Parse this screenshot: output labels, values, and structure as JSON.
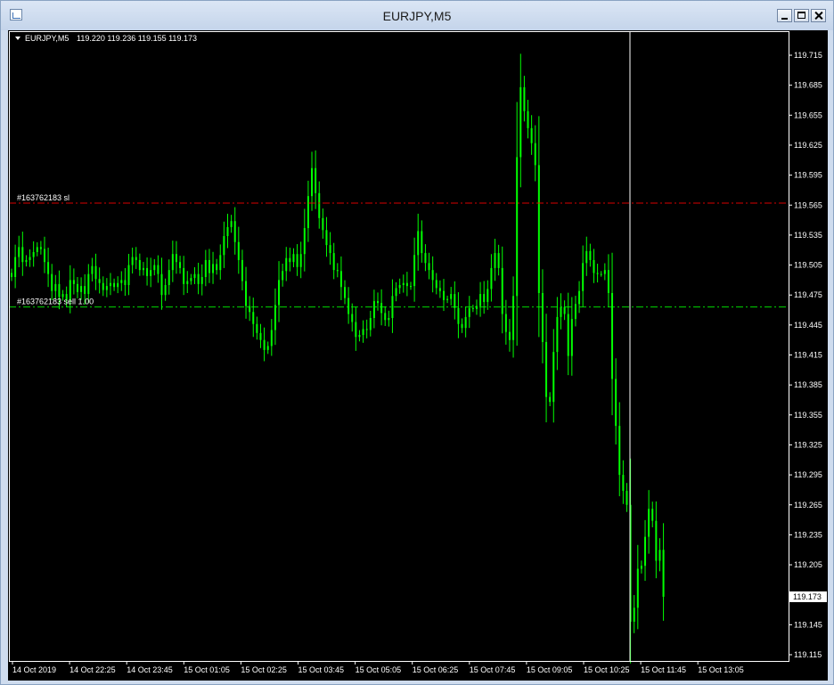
{
  "window": {
    "title": "EURJPY,M5"
  },
  "chart_info": {
    "symbol_label": "EURJPY,M5",
    "ohlc_label": "119.220 119.236 119.155 119.173"
  },
  "colors": {
    "background": "#000000",
    "candle": "#00ff00",
    "axis": "#ffffff",
    "sl_line": "#ff0000",
    "tp_line": "#00ff00"
  },
  "chart_data": {
    "type": "candlestick",
    "symbol": "EURJPY",
    "timeframe": "M5",
    "ylim": [
      119.11,
      119.73
    ],
    "yticks": [
      "119.715",
      "119.685",
      "119.655",
      "119.625",
      "119.595",
      "119.565",
      "119.535",
      "119.505",
      "119.475",
      "119.445",
      "119.415",
      "119.385",
      "119.355",
      "119.325",
      "119.295",
      "119.265",
      "119.235",
      "119.205",
      "119.175",
      "119.145",
      "119.115"
    ],
    "xticks": [
      "14 Oct 2019",
      "14 Oct 22:25",
      "14 Oct 23:45",
      "15 Oct 01:05",
      "15 Oct 02:25",
      "15 Oct 03:45",
      "15 Oct 05:05",
      "15 Oct 06:25",
      "15 Oct 07:45",
      "15 Oct 09:05",
      "15 Oct 10:25",
      "15 Oct 11:45",
      "15 Oct 13:05"
    ],
    "current_price": "119.173",
    "levels": [
      {
        "label": "#163762183 sl",
        "price": 119.567
      },
      {
        "label": "#163762183 sell 1.00",
        "price": 119.463
      }
    ],
    "crosshair_time": "15 Oct 10:25",
    "closes": [
      119.493,
      119.513,
      119.523,
      119.508,
      119.51,
      119.513,
      119.518,
      119.523,
      119.521,
      119.508,
      119.496,
      119.479,
      119.486,
      119.473,
      119.476,
      119.47,
      119.49,
      119.486,
      119.478,
      119.484,
      119.476,
      119.496,
      119.504,
      119.491,
      119.487,
      119.48,
      119.484,
      119.487,
      119.483,
      119.487,
      119.49,
      119.485,
      119.505,
      119.513,
      119.51,
      119.5,
      119.502,
      119.494,
      119.5,
      119.505,
      119.496,
      119.475,
      119.485,
      119.5,
      119.516,
      119.508,
      119.502,
      119.486,
      119.489,
      119.492,
      119.496,
      119.486,
      119.493,
      119.51,
      119.497,
      119.506,
      119.5,
      119.515,
      119.534,
      119.543,
      119.549,
      119.528,
      119.51,
      119.489,
      119.464,
      119.458,
      119.446,
      119.437,
      119.43,
      119.42,
      119.424,
      119.44,
      119.465,
      119.49,
      119.499,
      119.512,
      119.508,
      119.516,
      119.503,
      119.516,
      119.542,
      119.574,
      119.602,
      119.577,
      119.552,
      119.54,
      119.525,
      119.517,
      119.5,
      119.499,
      119.483,
      119.472,
      119.456,
      119.448,
      119.433,
      119.435,
      119.441,
      119.44,
      119.452,
      119.469,
      119.467,
      119.457,
      119.45,
      119.452,
      119.474,
      119.482,
      119.485,
      119.487,
      119.484,
      119.484,
      119.515,
      119.539,
      119.517,
      119.507,
      119.5,
      119.49,
      119.482,
      119.479,
      119.47,
      119.471,
      119.476,
      119.462,
      119.446,
      119.442,
      119.453,
      119.462,
      119.461,
      119.464,
      119.476,
      119.468,
      119.481,
      119.502,
      119.517,
      119.502,
      119.456,
      119.438,
      119.43,
      119.474,
      119.613,
      119.683,
      119.659,
      119.642,
      119.627,
      119.605,
      119.477,
      119.428,
      119.373,
      119.368,
      119.418,
      119.453,
      119.463,
      119.456,
      119.414,
      119.451,
      119.466,
      119.479,
      119.507,
      119.519,
      119.51,
      119.497,
      119.496,
      119.496,
      119.5,
      119.477,
      119.391,
      119.344,
      119.295,
      119.279,
      119.265,
      119.148,
      119.162,
      119.201,
      119.204,
      119.233,
      119.261,
      119.249,
      119.209,
      119.22,
      119.173
    ]
  }
}
